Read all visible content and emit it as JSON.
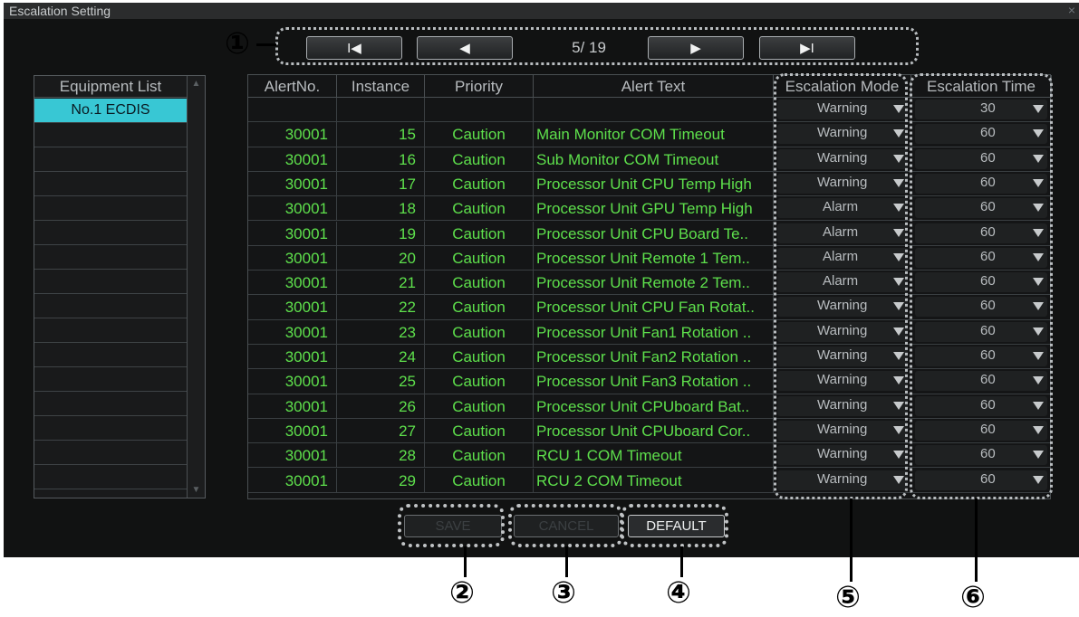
{
  "window": {
    "title": "Escalation Setting",
    "close_glyph": "×"
  },
  "pager": {
    "first_label": "I◀",
    "prev_label": "◀",
    "page_text": "5/ 19",
    "next_label": "▶",
    "last_label": "▶I"
  },
  "equipment": {
    "header": "Equipment List",
    "items": [
      "No.1 ECDIS"
    ]
  },
  "table": {
    "headers": [
      "AlertNo.",
      "Instance",
      "Priority",
      "Alert Text",
      "Escalation Mode",
      "Escalation Time"
    ],
    "default_row": {
      "mode": "Warning",
      "time": "30"
    },
    "rows": [
      {
        "alert_no": "30001",
        "instance": "15",
        "priority": "Caution",
        "text": "Main Monitor COM Timeout",
        "mode": "Warning",
        "time": "60"
      },
      {
        "alert_no": "30001",
        "instance": "16",
        "priority": "Caution",
        "text": "Sub Monitor COM Timeout",
        "mode": "Warning",
        "time": "60"
      },
      {
        "alert_no": "30001",
        "instance": "17",
        "priority": "Caution",
        "text": "Processor Unit CPU Temp High",
        "mode": "Warning",
        "time": "60"
      },
      {
        "alert_no": "30001",
        "instance": "18",
        "priority": "Caution",
        "text": "Processor Unit GPU Temp High",
        "mode": "Alarm",
        "time": "60"
      },
      {
        "alert_no": "30001",
        "instance": "19",
        "priority": "Caution",
        "text": "Processor Unit CPU Board Te..",
        "mode": "Alarm",
        "time": "60"
      },
      {
        "alert_no": "30001",
        "instance": "20",
        "priority": "Caution",
        "text": "Processor Unit Remote 1 Tem..",
        "mode": "Alarm",
        "time": "60"
      },
      {
        "alert_no": "30001",
        "instance": "21",
        "priority": "Caution",
        "text": "Processor Unit Remote 2 Tem..",
        "mode": "Alarm",
        "time": "60"
      },
      {
        "alert_no": "30001",
        "instance": "22",
        "priority": "Caution",
        "text": "Processor Unit CPU Fan Rotat..",
        "mode": "Warning",
        "time": "60"
      },
      {
        "alert_no": "30001",
        "instance": "23",
        "priority": "Caution",
        "text": "Processor Unit Fan1 Rotation ..",
        "mode": "Warning",
        "time": "60"
      },
      {
        "alert_no": "30001",
        "instance": "24",
        "priority": "Caution",
        "text": "Processor Unit Fan2 Rotation ..",
        "mode": "Warning",
        "time": "60"
      },
      {
        "alert_no": "30001",
        "instance": "25",
        "priority": "Caution",
        "text": "Processor Unit Fan3 Rotation ..",
        "mode": "Warning",
        "time": "60"
      },
      {
        "alert_no": "30001",
        "instance": "26",
        "priority": "Caution",
        "text": "Processor Unit CPUboard Bat..",
        "mode": "Warning",
        "time": "60"
      },
      {
        "alert_no": "30001",
        "instance": "27",
        "priority": "Caution",
        "text": "Processor Unit CPUboard Cor..",
        "mode": "Warning",
        "time": "60"
      },
      {
        "alert_no": "30001",
        "instance": "28",
        "priority": "Caution",
        "text": "RCU 1 COM Timeout",
        "mode": "Warning",
        "time": "60"
      },
      {
        "alert_no": "30001",
        "instance": "29",
        "priority": "Caution",
        "text": "RCU 2 COM Timeout",
        "mode": "Warning",
        "time": "60"
      }
    ]
  },
  "buttons": {
    "save": "SAVE",
    "cancel": "CANCEL",
    "default": "DEFAULT"
  },
  "callouts": [
    "①",
    "②",
    "③",
    "④",
    "⑤",
    "⑥"
  ],
  "colors": {
    "background": "#111212",
    "text_green": "#5ee04c",
    "selection_cyan": "#38c7d4"
  }
}
